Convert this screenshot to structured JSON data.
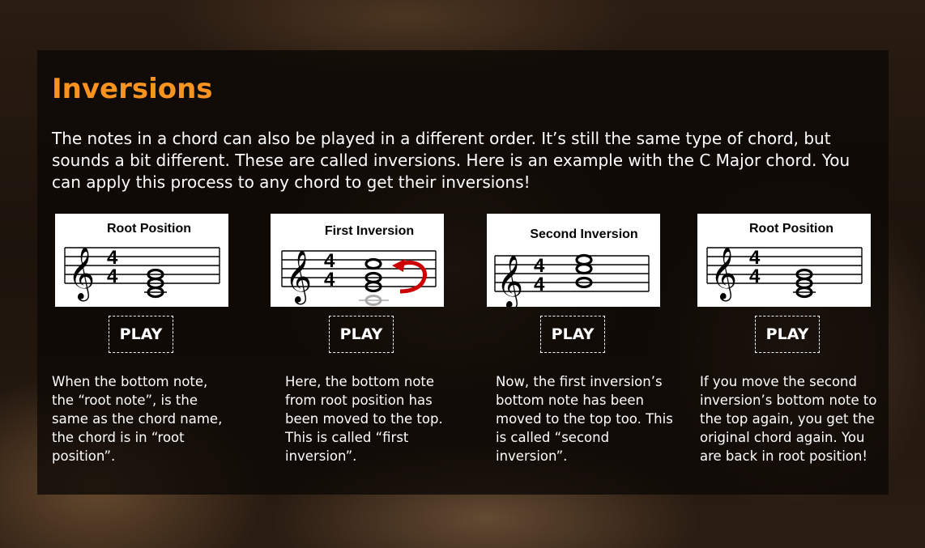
{
  "section": {
    "title": "Inversions",
    "intro": "The notes in a chord can also be played in a different order. It’s still the same type of chord, but sounds a bit different. These are called inversions. Here is an example with the C Major chord. You can apply this process to any chord to get their inversions!"
  },
  "examples": [
    {
      "heading": "Root Position",
      "play_label": "PLAY",
      "description": "When the bottom note, the “root note”, is the same as the chord name, the chord is in “root position”."
    },
    {
      "heading": "First Inversion",
      "play_label": "PLAY",
      "description": "Here, the bottom note from root position has been moved to the top. This is called “first inversion”."
    },
    {
      "heading": "Second Inversion",
      "play_label": "PLAY",
      "description": "Now, the first inversion’s bottom note has been moved to the top too. This is called “second inversion”."
    },
    {
      "heading": "Root Position",
      "play_label": "PLAY",
      "description": "If you move the second inversion’s bottom note to the top again, you get the original chord again. You are back in root position!"
    }
  ],
  "notation": {
    "time_signature_top": "4",
    "time_signature_bottom": "4",
    "clef_glyph": "𝄞"
  },
  "colors": {
    "accent": "#f7931e",
    "arrow": "#cc0000",
    "text": "#ffffff"
  }
}
